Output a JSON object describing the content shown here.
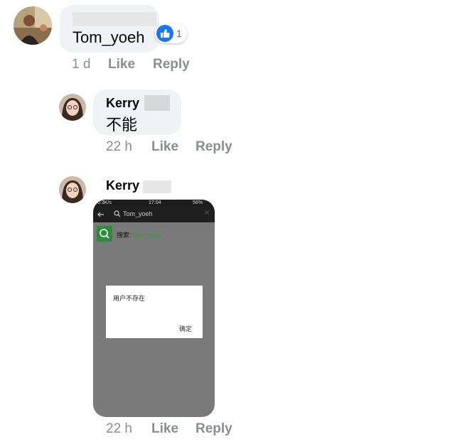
{
  "comments": [
    {
      "author": "",
      "text": "Tom_yoeh",
      "reaction": {
        "icon": "thumbs-up-icon",
        "count": "1",
        "color": "#1877f2"
      },
      "time": "1 d",
      "like_label": "Like",
      "reply_label": "Reply"
    },
    {
      "author": "Kerry",
      "text": "不能",
      "time": "22 h",
      "like_label": "Like",
      "reply_label": "Reply"
    },
    {
      "author": "Kerry",
      "attachment": {
        "status_left": "0.3K/s",
        "status_time": "17:04",
        "status_right": "56%",
        "search_query": "Tom_yoeh",
        "result_prefix": "搜索:",
        "result_query": "Tom_yoeh",
        "dialog_message": "用户不存在",
        "dialog_ok": "确定"
      },
      "time": "22 h",
      "like_label": "Like",
      "reply_label": "Reply"
    }
  ],
  "colors": {
    "bubble_bg": "#f0f2f5",
    "meta_text": "#8a8d91",
    "accent_green": "#2e8b3a"
  }
}
